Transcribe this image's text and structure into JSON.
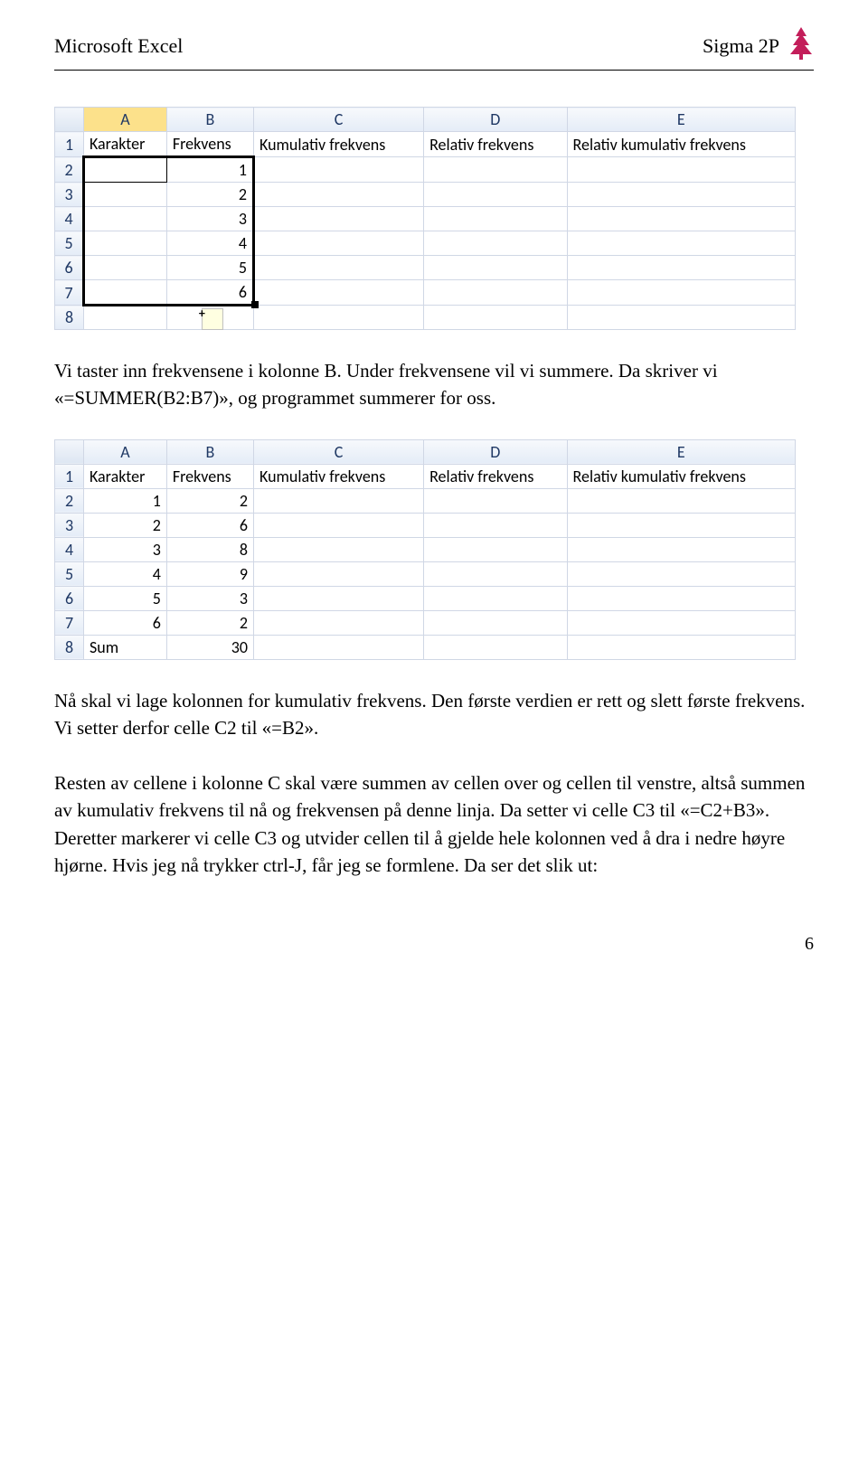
{
  "header": {
    "left": "Microsoft Excel",
    "right": "Sigma 2P"
  },
  "sheet1": {
    "cols": [
      "A",
      "B",
      "C",
      "D",
      "E"
    ],
    "rows": [
      "1",
      "2",
      "3",
      "4",
      "5",
      "6",
      "7",
      "8"
    ],
    "cells": {
      "A1": "Karakter",
      "B1": "Frekvens",
      "C1": "Kumulativ frekvens",
      "D1": "Relativ frekvens",
      "E1": "Relativ kumulativ frekvens",
      "B2": "1",
      "B3": "2",
      "B4": "3",
      "B5": "4",
      "B6": "5",
      "B7": "6"
    }
  },
  "para1": "Vi taster inn frekvensene i kolonne B. Under frekvensene vil vi summere. Da skriver vi «=SUMMER(B2:B7)», og programmet summerer for oss.",
  "sheet2": {
    "cols": [
      "A",
      "B",
      "C",
      "D",
      "E"
    ],
    "rows": [
      "1",
      "2",
      "3",
      "4",
      "5",
      "6",
      "7",
      "8"
    ],
    "cells": {
      "A1": "Karakter",
      "B1": "Frekvens",
      "C1": "Kumulativ frekvens",
      "D1": "Relativ frekvens",
      "E1": "Relativ kumulativ frekvens",
      "A2": "1",
      "B2": "2",
      "A3": "2",
      "B3": "6",
      "A4": "3",
      "B4": "8",
      "A5": "4",
      "B5": "9",
      "A6": "5",
      "B6": "3",
      "A7": "6",
      "B7": "2",
      "A8": "Sum",
      "B8": "30"
    }
  },
  "para2": "Nå skal vi lage kolonnen for kumulativ frekvens. Den første verdien er rett og slett første frekvens. Vi setter derfor celle C2 til «=B2».",
  "para3": "Resten av cellene i kolonne C skal være summen av cellen over og cellen til venstre, altså summen av kumulativ frekvens til nå og frekvensen på denne linja. Da setter vi celle C3 til «=C2+B3». Deretter markerer vi celle C3 og utvider cellen til å gjelde hele kolonnen ved å dra i nedre høyre hjørne. Hvis jeg nå trykker ctrl-J, får jeg se formlene. Da ser det slik ut:",
  "page_number": "6"
}
